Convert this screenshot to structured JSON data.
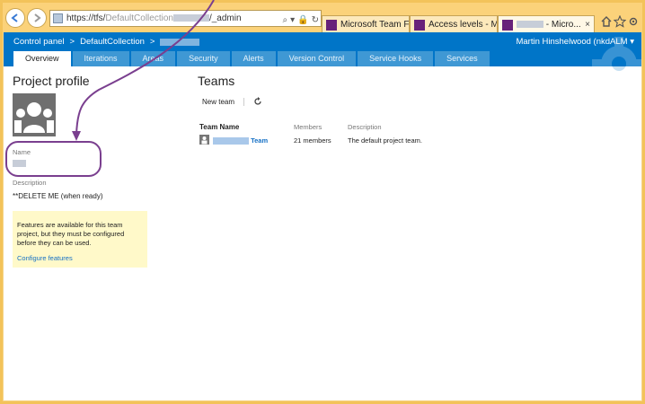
{
  "browser": {
    "url_prefix": "https://tfs/",
    "url_gray": "DefaultCollection",
    "url_suffix": "/_admin",
    "tabs": [
      {
        "label": "Microsoft Team Found..."
      },
      {
        "label": "Access levels - Microso..."
      },
      {
        "label": "- Micro..."
      }
    ]
  },
  "header": {
    "control_panel": "Control panel",
    "sep1": ">",
    "collection": "DefaultCollection",
    "sep2": ">",
    "user": "Martin Hinshelwood (nkdALM"
  },
  "nav_tabs": [
    "Overview",
    "Iterations",
    "Areas",
    "Security",
    "Alerts",
    "Version Control",
    "Service Hooks",
    "Services"
  ],
  "profile": {
    "title": "Project profile",
    "name_label": "Name",
    "description_label": "Description",
    "description_value": "**DELETE ME (when ready)",
    "notice_text": "Features are available for this team project, but they must be configured before they can be used.",
    "configure_link": "Configure features"
  },
  "teams": {
    "title": "Teams",
    "new_team": "New team",
    "columns": [
      "Team Name",
      "Members",
      "Description"
    ],
    "rows": [
      {
        "name": "Team",
        "members": "21 members",
        "description": "The default project team."
      }
    ]
  },
  "colors": {
    "header_blue": "#0075c8",
    "link_blue": "#1570c5",
    "annotation_purple": "#7a3f8f",
    "notice_yellow": "#fff9c9"
  }
}
